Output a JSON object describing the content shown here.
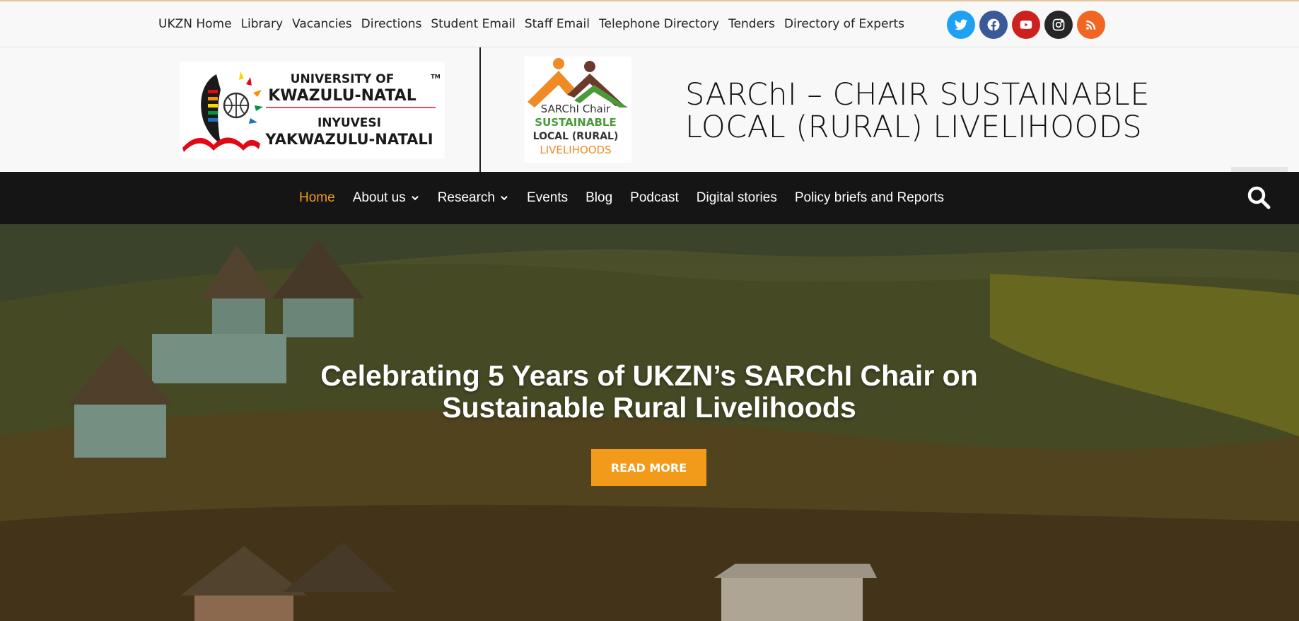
{
  "toplinks": [
    "UKZN Home",
    "Library",
    "Vacancies",
    "Directions",
    "Student Email",
    "Staff Email",
    "Telephone Directory",
    "Tenders",
    "Directory of Experts"
  ],
  "socials": [
    {
      "name": "twitter-icon",
      "color": "#1da1f2"
    },
    {
      "name": "facebook-icon",
      "color": "#3b5998"
    },
    {
      "name": "youtube-icon",
      "color": "#cd201f"
    },
    {
      "name": "instagram-icon",
      "color": "#262626"
    },
    {
      "name": "rss-icon",
      "color": "#f26522"
    }
  ],
  "logos": {
    "ukzn": {
      "line1": "UNIVERSITY OF",
      "line2": "KWAZULU-NATAL",
      "line3": "INYUVESI",
      "line4": "YAKWAZULU-NATALI",
      "tm": "TM"
    },
    "sarchi": {
      "line1": "SARChI Chair",
      "line2": "SUSTAINABLE",
      "line3": "LOCAL (RURAL)",
      "line4": "LIVELIHOODS"
    }
  },
  "site_title": "SARChI – CHAIR SUSTAINABLE LOCAL (RURAL) LIVELIHOODS",
  "nav": {
    "items": [
      {
        "label": "Home",
        "active": true,
        "dropdown": false
      },
      {
        "label": "About us",
        "active": false,
        "dropdown": true
      },
      {
        "label": "Research",
        "active": false,
        "dropdown": true
      },
      {
        "label": "Events",
        "active": false,
        "dropdown": false
      },
      {
        "label": "Blog",
        "active": false,
        "dropdown": false
      },
      {
        "label": "Podcast",
        "active": false,
        "dropdown": false
      },
      {
        "label": "Digital stories",
        "active": false,
        "dropdown": false
      },
      {
        "label": "Policy briefs and Reports",
        "active": false,
        "dropdown": false
      }
    ],
    "active_color": "#f29b1a"
  },
  "hero": {
    "title_line1": "Celebrating 5 Years of UKZN’s SARChI Chair on",
    "title_line2": "Sustainable Rural Livelihoods",
    "button_label": "READ MORE",
    "button_color": "#f29b1a"
  }
}
